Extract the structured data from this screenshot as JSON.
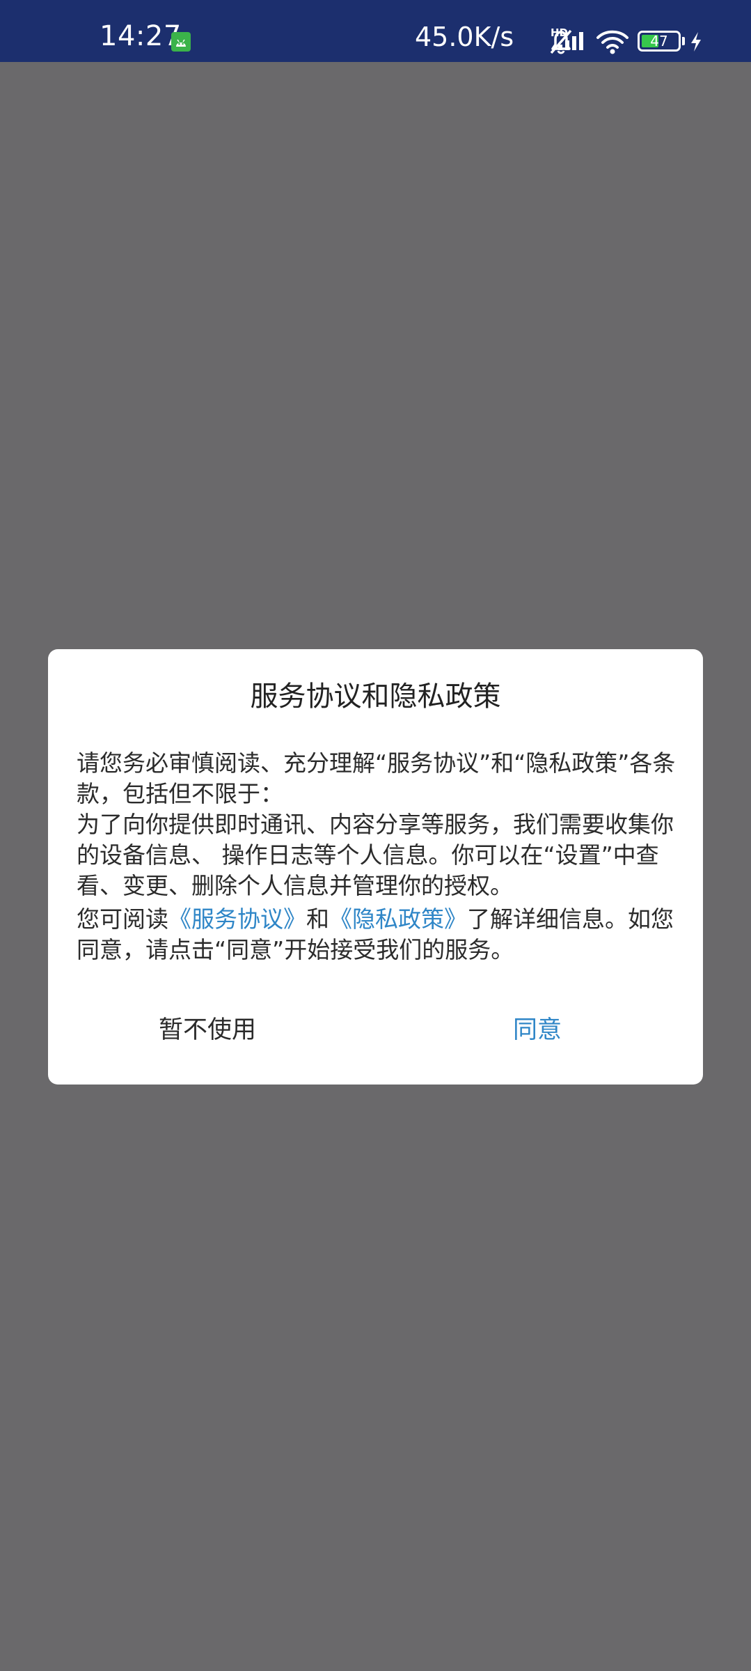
{
  "status_bar": {
    "time": "14:27",
    "net_speed": "45.0K/s",
    "hd_label": "HD",
    "battery_level": "47",
    "battery_fraction": 0.47
  },
  "icons": {
    "app_notification": "android-app-icon",
    "mute": "bell-muted-icon",
    "signal": "cell-signal-icon",
    "wifi": "wifi-icon",
    "battery": "battery-icon",
    "charging": "charging-bolt-icon"
  },
  "colors": {
    "status_bar_bg": "#1c2f6e",
    "overlay_bg": "#6a696b",
    "link": "#2f86c7",
    "battery_fill": "#37c84c"
  },
  "dialog": {
    "title": "服务协议和隐私政策",
    "para1": "请您务必审慎阅读、充分理解“服务协议”和“隐私政策”各条款，包括但不限于：",
    "para2": "为了向你提供即时通讯、内容分享等服务，我们需要收集你的设备信息、 操作日志等个人信息。你可以在“设置”中查看、变更、删除个人信息并管理你的授权。",
    "para3_prefix": "您可阅读",
    "service_link": "《服务协议》",
    "para3_and": "和",
    "privacy_link": "《隐私政策》",
    "para3_suffix": "了解详细信息。如您同意，请点击“同意”开始接受我们的服务。",
    "cancel_label": "暂不使用",
    "agree_label": "同意"
  }
}
